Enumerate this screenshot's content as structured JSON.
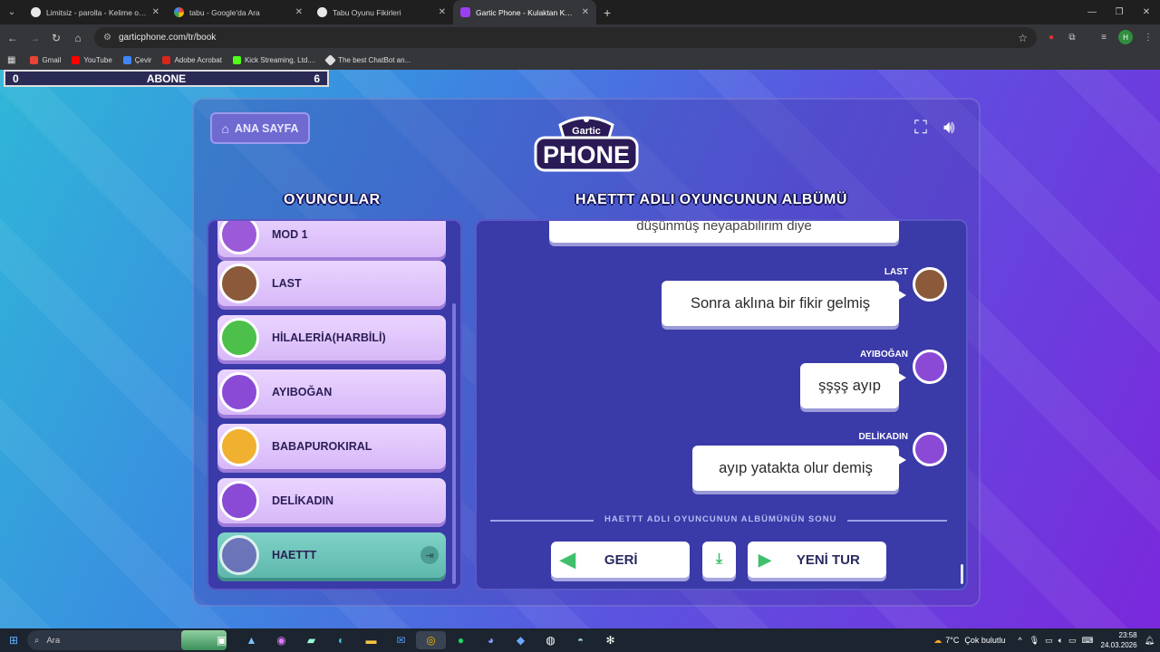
{
  "browser": {
    "tabs": [
      {
        "title": "Limitsiz - parolla - Kelime oyunu",
        "favicon": "limitsiz-icon",
        "active": false
      },
      {
        "title": "tabu - Google'da Ara",
        "favicon": "google-icon",
        "active": false
      },
      {
        "title": "Tabu Oyunu Fikirleri",
        "favicon": "chatgpt-icon",
        "active": false
      },
      {
        "title": "Gartic Phone - Kulaktan Kulağa",
        "favicon": "gartic-icon",
        "active": true
      }
    ],
    "new_tab": "+",
    "url": "garticphone.com/tr/book",
    "profile_initial": "H",
    "bookmarks": [
      {
        "label": "Gmail",
        "color": "#ea4335"
      },
      {
        "label": "YouTube",
        "color": "#ff0000"
      },
      {
        "label": "Çevir",
        "color": "#4285f4"
      },
      {
        "label": "Adobe Acrobat",
        "color": "#d8261d"
      },
      {
        "label": "Kick Streaming, Ltd....",
        "color": "#53fc18"
      },
      {
        "label": "The best ChatBot an...",
        "color": "#dddddd"
      }
    ]
  },
  "overlay": {
    "left": "0",
    "center": "ABONE",
    "right": "6"
  },
  "game": {
    "home_label": "ANA SAYFA",
    "logo_top": "Gartic",
    "logo_bottom": "PHONE",
    "players_title": "OYUNCULAR",
    "album_title": "HAETTT ADLI OYUNCUNUN ALBÜMÜ",
    "players": [
      {
        "name": "MOD 1",
        "avatar_color": "#9b5ad8",
        "active": false
      },
      {
        "name": "LAST",
        "avatar_color": "#8a5a3a",
        "active": false
      },
      {
        "name": "HİLALERİA(HARBİLİ)",
        "avatar_color": "#4cc04a",
        "active": false
      },
      {
        "name": "AYIBOĞAN",
        "avatar_color": "#8a4ad6",
        "active": false
      },
      {
        "name": "BABAPUROKIRAL",
        "avatar_color": "#f0b030",
        "active": false
      },
      {
        "name": "DELİKADIN",
        "avatar_color": "#8a4ad6",
        "active": false
      },
      {
        "name": "HAETTT",
        "avatar_color": "#6a5ab8",
        "active": true
      }
    ],
    "messages": [
      {
        "author": "",
        "text": "düşünmüş neyapabilirim diye",
        "avatar_color": ""
      },
      {
        "author": "LAST",
        "text": "Sonra aklına bir fikir gelmiş",
        "avatar_color": "#8a5a3a"
      },
      {
        "author": "AYIBOĞAN",
        "text": "şşşş ayıp",
        "avatar_color": "#8a4ad6"
      },
      {
        "author": "DELİKADIN",
        "text": "ayıp yatakta olur demiş",
        "avatar_color": "#8a4ad6"
      }
    ],
    "end_text": "HAETTT ADLI OYUNCUNUN ALBÜMÜNÜN SONU",
    "back_label": "GERİ",
    "new_round_label": "YENİ TUR"
  },
  "taskbar": {
    "search_placeholder": "Ara",
    "weather": "7°C",
    "weather_desc": "Çok bulutlu",
    "time": "23:58",
    "date": "24.03.2026"
  }
}
